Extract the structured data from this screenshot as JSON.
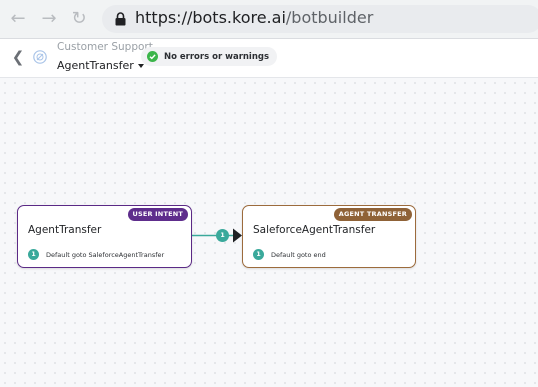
{
  "browser": {
    "back_icon": "arrow-left-icon",
    "forward_icon": "arrow-right-icon",
    "reload_icon": "reload-icon",
    "lock_icon": "lock-icon",
    "url_base": "https://bots.kore.ai",
    "url_path": "/botbuilder"
  },
  "header": {
    "back_icon": "chevron-left-icon",
    "bot_icon": "bot-icon",
    "bot_name": "Customer Support",
    "task_name": "AgentTransfer",
    "status_text": "No errors or warnings",
    "status_icon": "check-circle-icon",
    "status_color": "#3bb54a"
  },
  "flow": {
    "nodes": [
      {
        "badge": "USER INTENT",
        "badge_color": "#5e2d8c",
        "title": "AgentTransfer",
        "rule_num": "1",
        "rule_text": "Default goto SaleforceAgentTransfer"
      },
      {
        "badge": "AGENT TRANSFER",
        "badge_color": "#8f6237",
        "title": "SaleforceAgentTransfer",
        "rule_num": "1",
        "rule_text": "Default goto end"
      }
    ],
    "edge_label": "1",
    "edge_color": "#3aa99b"
  }
}
